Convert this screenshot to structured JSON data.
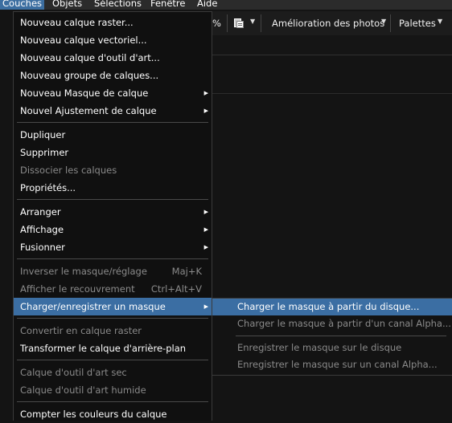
{
  "menubar": {
    "items": [
      "Couches",
      "Objets",
      "Sélections",
      "Fenêtre",
      "Aide"
    ]
  },
  "toolbar": {
    "percent": "%",
    "photo_improve": "Amélioration des photos",
    "palettes": "Palettes"
  },
  "layers_menu": {
    "items": [
      {
        "label": "Nouveau calque raster...",
        "enabled": true
      },
      {
        "label": "Nouveau calque vectoriel...",
        "enabled": true
      },
      {
        "label": "Nouveau calque d'outil d'art...",
        "enabled": true
      },
      {
        "label": "Nouveau groupe de calques...",
        "enabled": true
      },
      {
        "label": "Nouveau Masque de calque",
        "enabled": true,
        "submenu": true
      },
      {
        "label": "Nouvel Ajustement de calque",
        "enabled": true,
        "submenu": true
      },
      {
        "label": "Dupliquer",
        "enabled": true
      },
      {
        "label": "Supprimer",
        "enabled": true
      },
      {
        "label": "Dissocier les calques",
        "enabled": false
      },
      {
        "label": "Propriétés...",
        "enabled": true
      },
      {
        "label": "Arranger",
        "enabled": true,
        "submenu": true
      },
      {
        "label": "Affichage",
        "enabled": true,
        "submenu": true
      },
      {
        "label": "Fusionner",
        "enabled": true,
        "submenu": true
      },
      {
        "label": "Inverser le masque/réglage",
        "enabled": false,
        "shortcut": "Maj+K"
      },
      {
        "label": "Afficher le recouvrement",
        "enabled": false,
        "shortcut": "Ctrl+Alt+V"
      },
      {
        "label": "Charger/enregistrer un masque",
        "enabled": true,
        "submenu": true,
        "highlighted": true
      },
      {
        "label": "Convertir en calque raster",
        "enabled": false
      },
      {
        "label": "Transformer le calque d'arrière-plan",
        "enabled": true
      },
      {
        "label": "Calque d'outil d'art sec",
        "enabled": false
      },
      {
        "label": "Calque d'outil d'art humide",
        "enabled": false
      },
      {
        "label": "Compter les couleurs du calque",
        "enabled": true
      }
    ]
  },
  "mask_submenu": {
    "items": [
      {
        "label": "Charger le masque à partir du disque...",
        "enabled": true,
        "highlighted": true
      },
      {
        "label": "Charger le masque à partir d'un canal Alpha...",
        "enabled": false
      },
      {
        "label": "Enregistrer le masque sur le disque",
        "enabled": false
      },
      {
        "label": "Enregistrer le masque sur un canal Alpha...",
        "enabled": false
      }
    ]
  },
  "colors": {
    "highlight": "#3b6ea3",
    "menu_bg": "#101010",
    "disabled_text": "#8a8a8a"
  }
}
